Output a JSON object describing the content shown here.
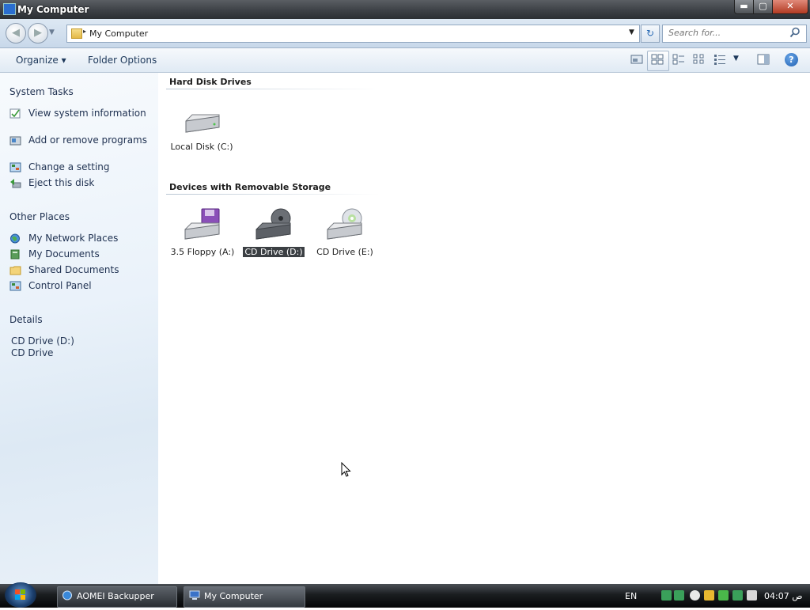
{
  "window": {
    "title": "My Computer",
    "min": "▬",
    "max": "▢",
    "close": "✕"
  },
  "address": {
    "crumb_arrow": "▸",
    "text": "My Computer",
    "dropdown": "▼",
    "refresh": "↻",
    "search_placeholder": "Search for..."
  },
  "toolbar": {
    "organize": "Organize ▾",
    "folder_options": "Folder Options",
    "help": "?"
  },
  "sidebar": {
    "system_tasks_title": "System Tasks",
    "system_tasks": [
      {
        "label": "View system information",
        "icon": "system-info-icon"
      },
      {
        "label": "Add or remove programs",
        "icon": "add-remove-programs-icon"
      },
      {
        "label": "Change a setting",
        "icon": "control-panel-icon"
      },
      {
        "label": "Eject this disk",
        "icon": "eject-icon"
      }
    ],
    "other_places_title": "Other Places",
    "other_places": [
      {
        "label": "My Network Places",
        "icon": "network-places-icon"
      },
      {
        "label": "My Documents",
        "icon": "my-documents-icon"
      },
      {
        "label": "Shared Documents",
        "icon": "folder-icon"
      },
      {
        "label": "Control Panel",
        "icon": "control-panel-icon"
      }
    ],
    "details_title": "Details",
    "details_name": "CD Drive (D:)",
    "details_type": "CD Drive"
  },
  "content": {
    "hard_disk_title": "Hard Disk Drives",
    "hard_disks": [
      {
        "label": "Local Disk (C:)",
        "icon": "hard-disk-icon"
      }
    ],
    "removable_title": "Devices with Removable Storage",
    "removable": [
      {
        "label": "3.5 Floppy (A:)",
        "icon": "floppy-drive-icon"
      },
      {
        "label": "CD Drive (D:)",
        "icon": "cd-drive-icon",
        "selected": true
      },
      {
        "label": "CD Drive (E:)",
        "icon": "cd-drive-icon"
      }
    ]
  },
  "taskbar": {
    "tasks": [
      {
        "label": "AOMEI Backupper"
      },
      {
        "label": "My Computer"
      }
    ],
    "language": "EN",
    "clock": "04:07 ص"
  },
  "colors": {
    "selection": "#3b3f43",
    "sidebar_text": "#1e3050",
    "accent": "#2a6bb5"
  }
}
